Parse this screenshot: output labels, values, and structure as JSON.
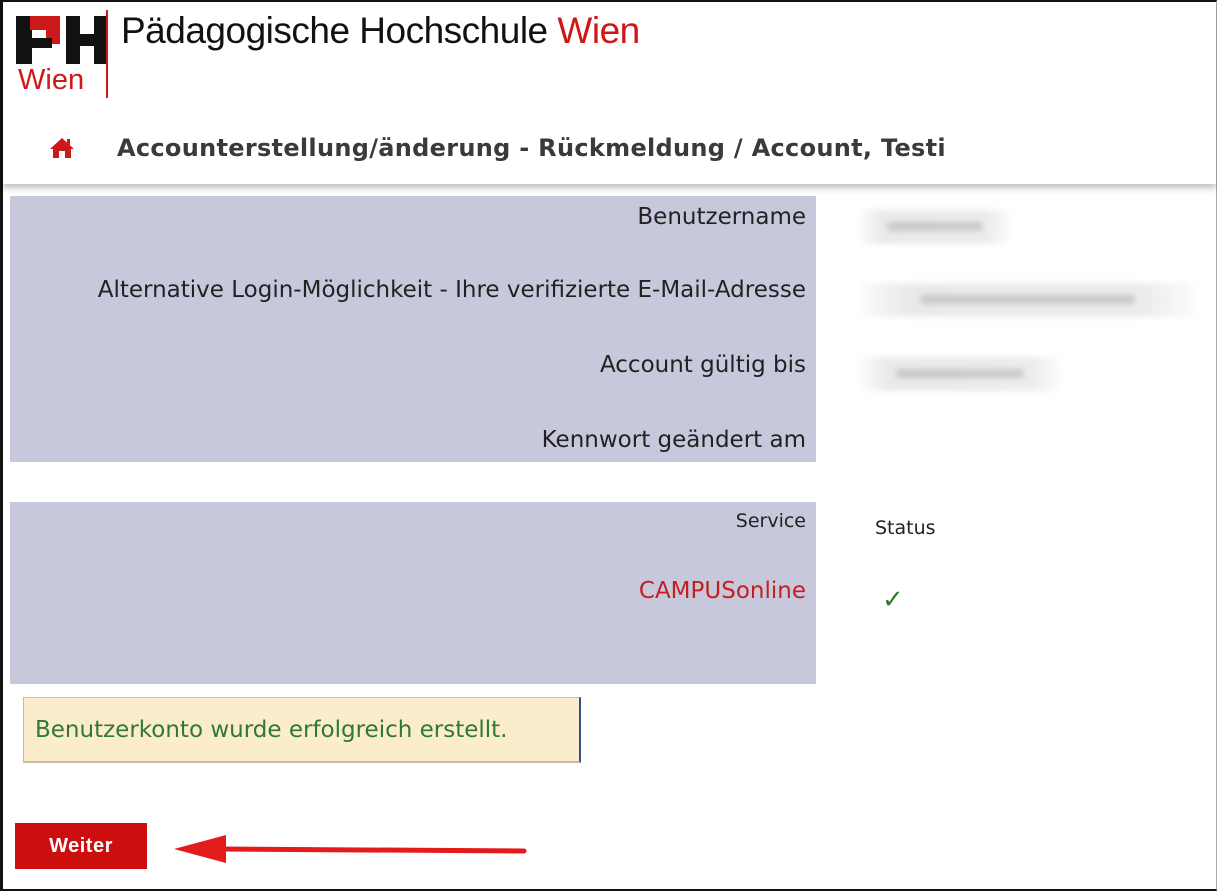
{
  "header": {
    "logo_text": "Wien",
    "title_main": "Pädagogische Hochschule ",
    "title_city": "Wien",
    "breadcrumb": "Accounterstellung/änderung - Rückmeldung  / Account, Testi"
  },
  "account_panel": {
    "rows": [
      {
        "label": "Benutzername",
        "value_blurred": true
      },
      {
        "label": "Alternative Login-Möglichkeit - Ihre verifizierte E-Mail-Adresse",
        "value_blurred": true
      },
      {
        "label": "Account gültig bis",
        "value_blurred": true
      },
      {
        "label": "Kennwort geändert am",
        "value_blurred": false
      }
    ]
  },
  "services": {
    "service_header": "Service",
    "status_header": "Status",
    "items": [
      {
        "name": "CAMPUSonline",
        "status_icon": "checkmark-icon",
        "status_color": "#2e7d2e"
      }
    ]
  },
  "message": {
    "text": "Benutzerkonto wurde erfolgreich erstellt."
  },
  "actions": {
    "weiter_label": "Weiter"
  },
  "colors": {
    "brand_red": "#cc0e0e",
    "panel_bg": "#c8c8dc",
    "success_bg": "#fbeccc",
    "success_text": "#2f7a2f",
    "annotation_arrow": "#e31b1b"
  }
}
